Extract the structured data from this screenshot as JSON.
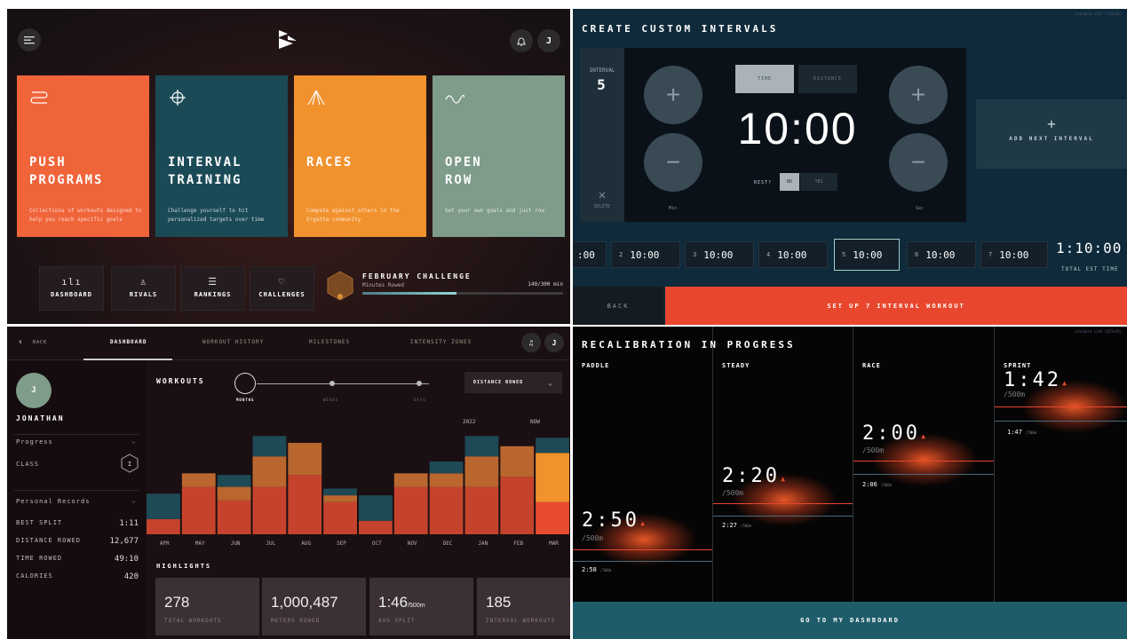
{
  "home": {
    "cards": [
      {
        "title_1": "PUSH",
        "title_2": "PROGRAMS",
        "desc": "Collections of workouts designed to help you reach specific goals",
        "color": "#f0643a"
      },
      {
        "title_1": "INTERVAL",
        "title_2": "TRAINING",
        "desc": "Challenge yourself to hit personalized targets over time",
        "color": "#1b4a57"
      },
      {
        "title_1": "",
        "title_2": "RACES",
        "desc": "Compete against others in the Ergatta community",
        "color": "#f1922e"
      },
      {
        "title_1": "OPEN",
        "title_2": "ROW",
        "desc": "Set your own goals and just row",
        "color": "#7f9b8a"
      }
    ],
    "nav": [
      {
        "label": "DASHBOARD",
        "icon": "chart-icon"
      },
      {
        "label": "RIVALS",
        "icon": "person-icon"
      },
      {
        "label": "RANKINGS",
        "icon": "list-icon"
      },
      {
        "label": "CHALLENGES",
        "icon": "trophy-icon"
      }
    ],
    "challenge": {
      "title": "FEBRUARY CHALLENGE",
      "subtitle": "Minutes Rowed",
      "progress_text": "140/300 min",
      "progress": 0.47
    },
    "avatar_initial": "J"
  },
  "intervals": {
    "title": "CREATE CUSTOM INTERVALS",
    "version": "standard v112 (54a21b)",
    "interval_label": "INTERVAL",
    "interval_number": "5",
    "delete_label": "DELETE",
    "toggle_time": "TIME",
    "toggle_distance": "DISTANCE",
    "time_value": "10:00",
    "rest_label": "REST?",
    "rest_no": "NO",
    "rest_yes": "YES",
    "min_label": "Min",
    "sec_label": "Sec",
    "add_next": "ADD NEXT INTERVAL",
    "list": [
      {
        "n": "",
        "v": ":00"
      },
      {
        "n": "2",
        "v": "10:00"
      },
      {
        "n": "3",
        "v": "10:00"
      },
      {
        "n": "4",
        "v": "10:00"
      },
      {
        "n": "5",
        "v": "10:00"
      },
      {
        "n": "6",
        "v": "10:00"
      },
      {
        "n": "7",
        "v": "10:00"
      }
    ],
    "total_time": "1:10:00",
    "total_label": "TOTAL EST TIME",
    "back": "BACK",
    "setup": "SET UP 7 INTERVAL WORKOUT"
  },
  "dashboard": {
    "back": "BACK",
    "tabs": [
      "DASHBOARD",
      "WORKOUT HISTORY",
      "MILESTONES",
      "INTENSITY ZONES"
    ],
    "user": {
      "initial": "J",
      "name": "JONATHAN"
    },
    "progress_label": "Progress",
    "class_label": "CLASS",
    "class_value": "I",
    "records_label": "Personal Records",
    "records": [
      {
        "label": "BEST SPLIT",
        "value": "1:11"
      },
      {
        "label": "DISTANCE ROWED",
        "value": "12,677"
      },
      {
        "label": "TIME ROWED",
        "value": "49:10"
      },
      {
        "label": "CALORIES",
        "value": "420"
      }
    ],
    "workouts_title": "WORKOUTS",
    "range": [
      "MONTHS",
      "WEEKS",
      "DAYS"
    ],
    "metric": "DISTANCE ROWED",
    "year_label": "2022",
    "now_label": "NOW",
    "highlights_title": "HIGHLIGHTS",
    "highlights": [
      {
        "value": "278",
        "unit": "",
        "label": "TOTAL WORKOUTS"
      },
      {
        "value": "1,000,487",
        "unit": "",
        "label": "METERS ROWED"
      },
      {
        "value": "1:46",
        "unit": "/500m",
        "label": "AVG SPLIT"
      },
      {
        "value": "185",
        "unit": "",
        "label": "INTERVAL WORKOUTS"
      }
    ]
  },
  "chart_data": {
    "type": "bar",
    "categories": [
      "APR",
      "MAY",
      "JUN",
      "JUL",
      "AUG",
      "SEP",
      "OCT",
      "NOV",
      "DEC",
      "JAN",
      "FEB",
      "MAR"
    ],
    "series": [
      {
        "values": [
          18,
          56,
          40,
          56,
          70,
          38,
          16,
          56,
          56,
          56,
          68,
          38
        ],
        "color": "#c5432c"
      },
      {
        "values": [
          0,
          16,
          16,
          36,
          38,
          8,
          0,
          16,
          16,
          36,
          36,
          58
        ],
        "color": "#b9672f"
      },
      {
        "values": [
          30,
          0,
          14,
          24,
          0,
          8,
          30,
          0,
          14,
          24,
          0,
          18
        ],
        "color": "#1e4a55"
      }
    ],
    "ylim": [
      0,
      130
    ],
    "colors": {
      "low": "#c5432c",
      "mid": "#b9672f",
      "high": "#1e4a55",
      "now_low": "#e84c2e",
      "now_mid": "#f2922d"
    }
  },
  "recal": {
    "title": "RECALIBRATION IN PROGRESS",
    "version": "standard v144 (815ef9)",
    "zones": [
      {
        "name": "PADDLE",
        "value": "2:50",
        "unit": "/500m",
        "prev": "2:58",
        "prev_unit": "/500m"
      },
      {
        "name": "STEADY",
        "value": "2:20",
        "unit": "/500m",
        "prev": "2:27",
        "prev_unit": "/500m"
      },
      {
        "name": "RACE",
        "value": "2:00",
        "unit": "/500m",
        "prev": "2:06",
        "prev_unit": "/500m"
      },
      {
        "name": "SPRINT",
        "value": "1:42",
        "unit": "/500m",
        "prev": "1:47",
        "prev_unit": "/500m"
      }
    ],
    "cta": "GO TO MY DASHBOARD"
  }
}
